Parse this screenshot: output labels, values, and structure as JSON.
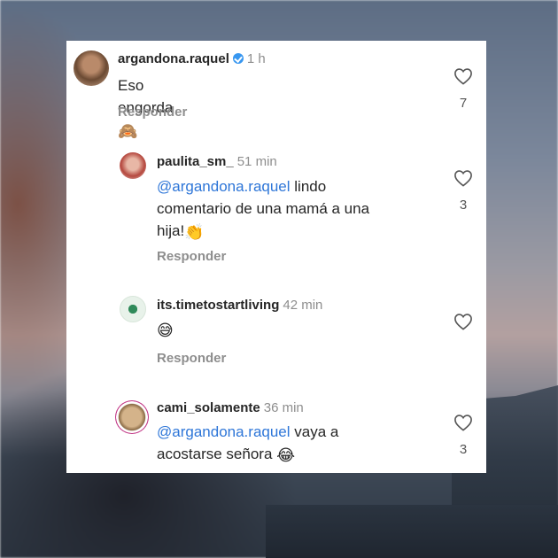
{
  "comments": [
    {
      "username": "argandona.raquel",
      "time": "1 h",
      "verified": true,
      "text": "Eso engorda",
      "emoji": "🙈",
      "reply_label": "Responder",
      "likes": "7"
    },
    {
      "username": "paulita_sm_",
      "time": "51 min",
      "mention": "@argandona.raquel",
      "text_line1": "lindo",
      "text_line2": "comentario de una mamá a una",
      "text_line3": "hija!",
      "emoji": "👏",
      "reply_label": "Responder",
      "likes": "3"
    },
    {
      "username": "its.timetostartliving",
      "time": "42 min",
      "emoji": "😅",
      "reply_label": "Responder",
      "likes": ""
    },
    {
      "username": "cami_solamente",
      "time": "36 min",
      "mention": "@argandona.raquel",
      "text_line1": "vaya a",
      "text_line2": "acostarse señora",
      "emoji": "😂",
      "likes": "3"
    }
  ],
  "icons": {
    "heart": "heart-icon",
    "verified": "verified-badge-icon"
  },
  "colors": {
    "mention": "#2e76d8",
    "verified": "#3897f0",
    "secondary_text": "#8e8e8e"
  }
}
